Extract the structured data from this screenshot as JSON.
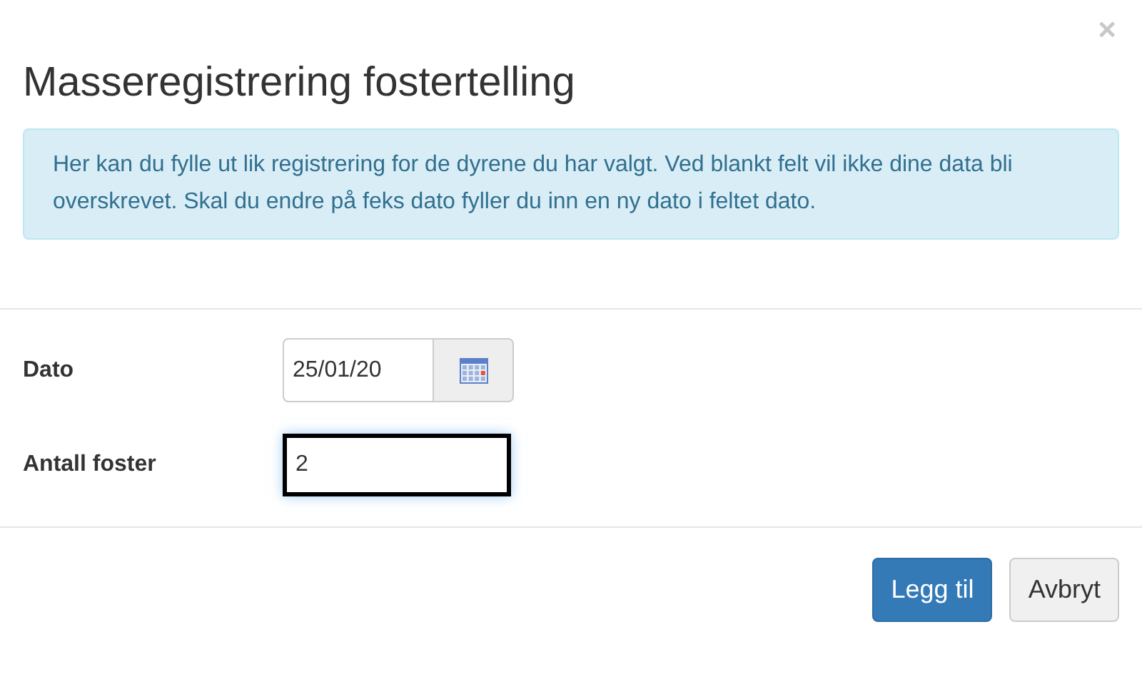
{
  "dialog": {
    "close": "×",
    "title": "Masseregistrering fostertelling",
    "info": "Her kan du fylle ut lik registrering for de dyrene du har valgt. Ved blankt felt vil ikke dine data bli overskrevet. Skal du endre på feks dato fyller du inn en ny dato i feltet dato.",
    "fields": [
      {
        "kind": "date",
        "label": "Dato",
        "value": "25/01/20",
        "focused": false
      },
      {
        "kind": "text",
        "label": "Antall foster",
        "value": "2",
        "focused": true
      }
    ],
    "buttons": [
      {
        "label": "Legg til",
        "primary": true
      },
      {
        "label": "Avbryt",
        "primary": false
      }
    ]
  }
}
